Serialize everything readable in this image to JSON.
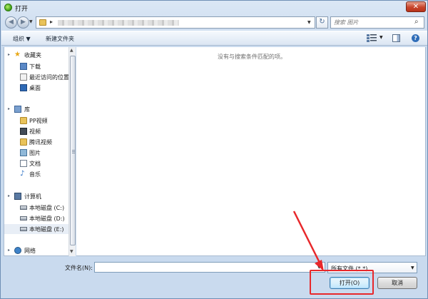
{
  "window": {
    "title": "打开",
    "close_glyph": "✕"
  },
  "navigation": {
    "back_glyph": "◀",
    "forward_glyph": "▶",
    "dropdown_glyph": "▼",
    "address_separator": "▸",
    "refresh_glyph": "↻"
  },
  "search": {
    "placeholder": "搜索 图片",
    "glyph": "⌕"
  },
  "toolbar": {
    "organize_label": "组织 ▼",
    "new_folder_label": "新建文件夹",
    "view_dropdown_glyph": "▼",
    "help_glyph": "?"
  },
  "sidebar": {
    "caret_glyph": "▸",
    "groups": [
      {
        "label": "收藏夹",
        "icon": "star-icon",
        "items": [
          {
            "label": "下载",
            "icon": "download-folder-icon"
          },
          {
            "label": "最近访问的位置",
            "icon": "recent-places-icon"
          },
          {
            "label": "桌面",
            "icon": "desktop-icon"
          }
        ]
      },
      {
        "label": "库",
        "icon": "library-icon",
        "items": [
          {
            "label": "PP视频",
            "icon": "folder-icon"
          },
          {
            "label": "视频",
            "icon": "video-icon"
          },
          {
            "label": "腾讯视频",
            "icon": "folder-icon"
          },
          {
            "label": "图片",
            "icon": "pictures-icon"
          },
          {
            "label": "文档",
            "icon": "documents-icon"
          },
          {
            "label": "音乐",
            "icon": "music-icon"
          }
        ]
      },
      {
        "label": "计算机",
        "icon": "computer-icon",
        "items": [
          {
            "label": "本地磁盘 (C:)",
            "icon": "drive-icon"
          },
          {
            "label": "本地磁盘 (D:)",
            "icon": "drive-icon"
          },
          {
            "label": "本地磁盘 (E:)",
            "icon": "drive-icon",
            "selected": true
          }
        ]
      },
      {
        "label": "网络",
        "icon": "network-icon",
        "items": []
      }
    ],
    "scroll_up_glyph": "▲",
    "scroll_down_glyph": "▼"
  },
  "content": {
    "empty_message": "没有与搜索条件匹配的项。"
  },
  "footer": {
    "filename_label": "文件名(N):",
    "filename_value": "",
    "filename_dropdown_glyph": "▼",
    "filter_selected": "所有文件 (*.*)",
    "filter_dropdown_glyph": "▼",
    "open_label": "打开(O)",
    "cancel_label": "取消"
  },
  "annotation": {
    "highlight_color": "#e8282b"
  }
}
